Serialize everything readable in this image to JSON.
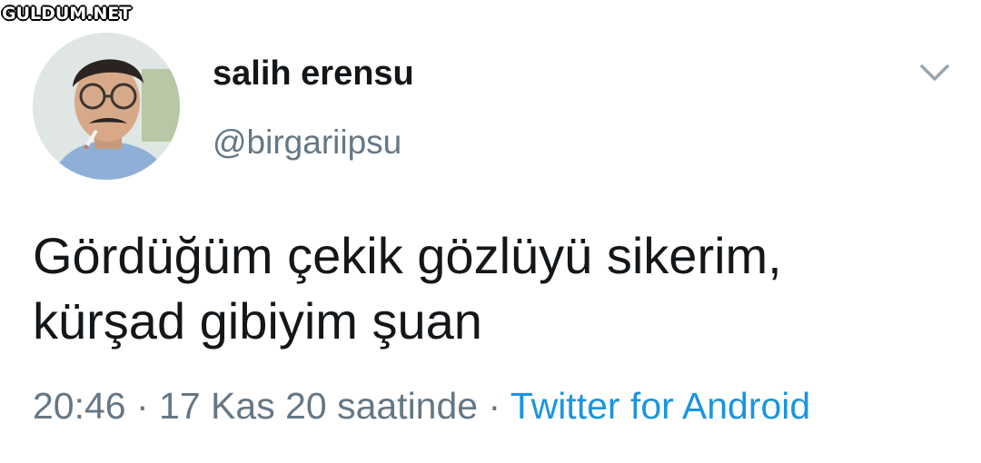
{
  "watermark": {
    "text": "GULDUM.NET"
  },
  "tweet": {
    "display_name": "salih erensu",
    "handle": "@birgariipsu",
    "text_lines": [
      "Gördüğüm çekik gözlüyü sikerim,",
      "kürşad gibiyim şuan"
    ],
    "time": "20:46",
    "separator": " · ",
    "date": "17 Kas 20 saatinde",
    "source": "Twitter for Android"
  },
  "icons": {
    "more": "chevron-down-icon",
    "avatar": "profile-photo"
  },
  "colors": {
    "name": "#14171a",
    "muted": "#657786",
    "link": "#1b95e0"
  }
}
